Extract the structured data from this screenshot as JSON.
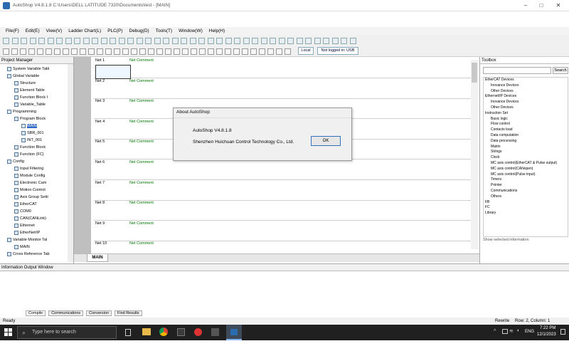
{
  "window": {
    "title": "AutoShop V4.8.1.8  C:\\Users\\DELL LATITUDE 7320\\Documents\\test - [MAIN]"
  },
  "menu": [
    "File(F)",
    "Edit(E)",
    "View(V)",
    "Ladder Chart(L)",
    "PLC(P)",
    "Debug(D)",
    "Tools(T)",
    "Window(W)",
    "Help(H)"
  ],
  "toolbar": {
    "local_label": "Local",
    "login_label": "Not logged in: USB"
  },
  "project_manager": {
    "title": "Project Manager",
    "items": [
      "System Variable Tabl",
      "Global Variable",
      "Structure",
      "Element Table",
      "Function Block I",
      "Variable_Table",
      "Programming",
      "Program Block",
      "MAIN",
      "SBR_001",
      "INT_001",
      "Function Block",
      "Function (FC)",
      "Config",
      "Input Filtering",
      "Module Config",
      "Electronic Cam",
      "Motion Control",
      "Axis Group Setti",
      "EtherCAT",
      "COM0",
      "CAN(CANLink)",
      "Ethernet",
      "EtherNet/IP",
      "Variable Monitor Tal",
      "MAIN",
      "Cross Reference Tab"
    ]
  },
  "editor": {
    "tab": "MAIN",
    "comment": "Net Comment",
    "nets": [
      "Net 1",
      "Net 2",
      "Net 3",
      "Net 4",
      "Net 5",
      "Net 6",
      "Net 7",
      "Net 8",
      "Net 9",
      "Net 10"
    ]
  },
  "toolbox": {
    "title": "Toolbox",
    "search": "Search",
    "footer": "Show selected information",
    "items": [
      "EtherCAT Devices",
      "Inovance Devices",
      "Other Devices",
      "Ethernet/IP Devices",
      "Inovance Devices",
      "Other Devices",
      "Instruction Set",
      "Basic logic",
      "Flow control",
      "Contacts load",
      "Data computation",
      "Data processing",
      "Matrix",
      "Strings",
      "Clock",
      "MC axis control(EtherCAT & Pulse output)",
      "MC axis control(CANopen)",
      "MC axis control(Pulse input)",
      "Timers",
      "Pointer",
      "Communications",
      "Others",
      "FB",
      "FC",
      "Library"
    ]
  },
  "info_window": {
    "title": "Information Output Window",
    "tabs": [
      "Compile",
      "Communications",
      "Conversion",
      "Find Results"
    ]
  },
  "status_bar": {
    "left": "Ready",
    "mode": "Rewrite",
    "position": "Row: 2, Column: 1"
  },
  "about_dialog": {
    "title": "About AutoShop",
    "version": "AutoShop V4.8.1.8",
    "company": "Shenzhen Huichuan Control Technology Co., Ltd.",
    "ok_label": "OK"
  },
  "taskbar": {
    "search_placeholder": "Type here to search",
    "lang": "ENG",
    "time": "7:22 PM",
    "date": "12/1/2023"
  }
}
